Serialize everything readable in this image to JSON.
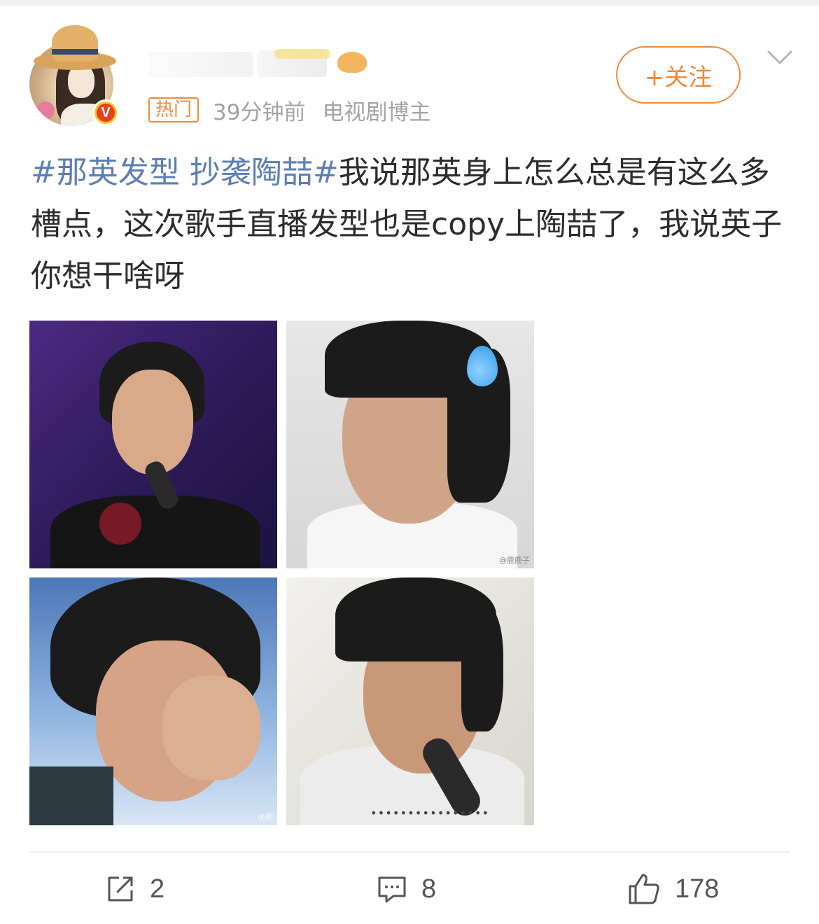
{
  "post": {
    "badge_label": "热门",
    "time_text": "39分钟前",
    "role_text": "电视剧博主",
    "follow_label": "+关注",
    "avatar_badge": "V",
    "text_hashtag": "#那英发型 抄袭陶喆#",
    "text_body": "我说那英身上怎么总是有这么多槽点，这次歌手直播发型也是copy上陶喆了，我说英子你想干啥呀"
  },
  "images": [
    {
      "id": "img-1",
      "watermark": ""
    },
    {
      "id": "img-2",
      "watermark": "@鹿鹿子"
    },
    {
      "id": "img-3",
      "watermark": "@剧"
    },
    {
      "id": "img-4",
      "watermark": "••••••••••••••••"
    }
  ],
  "actions": {
    "share_count": "2",
    "comment_count": "8",
    "like_count": "178"
  },
  "colors": {
    "accent": "#f08a3a",
    "hashtag": "#5a7fb4",
    "meta": "#a3a3a3"
  },
  "icons": [
    "share-icon",
    "comment-icon",
    "like-icon",
    "chevron-down-icon",
    "verified-icon"
  ]
}
